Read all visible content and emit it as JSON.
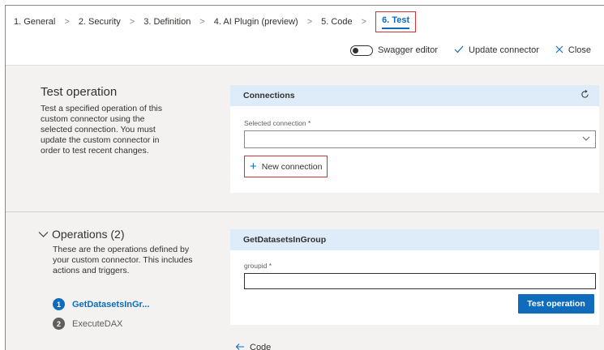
{
  "wizard": {
    "steps": [
      {
        "label": "1. General"
      },
      {
        "label": "2. Security"
      },
      {
        "label": "3. Definition"
      },
      {
        "label": "4. AI Plugin (preview)"
      },
      {
        "label": "5. Code"
      },
      {
        "label": "6. Test"
      }
    ],
    "separator": ">"
  },
  "toolbar": {
    "swagger_label": "Swagger editor",
    "update_label": "Update connector",
    "close_label": "Close",
    "update_icon": "checkmark-icon",
    "close_icon": "close-icon"
  },
  "test_section": {
    "title": "Test operation",
    "description": "Test a specified operation of this custom connector using the selected connection. You must update the custom connector in order to test recent changes."
  },
  "connections": {
    "title": "Connections",
    "selected_label": "Selected connection *",
    "selected_value": "",
    "new_connection_label": "New connection"
  },
  "operations": {
    "title": "Operations (2)",
    "description": "These are the operations defined by your custom connector. This includes actions and triggers.",
    "items": [
      {
        "number": "1",
        "name": "GetDatasetsInGr...",
        "active": true
      },
      {
        "number": "2",
        "name": "ExecuteDAX",
        "active": false
      }
    ]
  },
  "operation_card": {
    "title": "GetDatasetsInGroup",
    "param_label": "groupid *",
    "param_value": "",
    "test_button": "Test operation"
  },
  "nav": {
    "back_label": "Code"
  },
  "colors": {
    "accent": "#0f6cbd",
    "highlight_border": "#d13438",
    "card_header": "#deecf9",
    "page_bg": "#f3f2f1"
  }
}
